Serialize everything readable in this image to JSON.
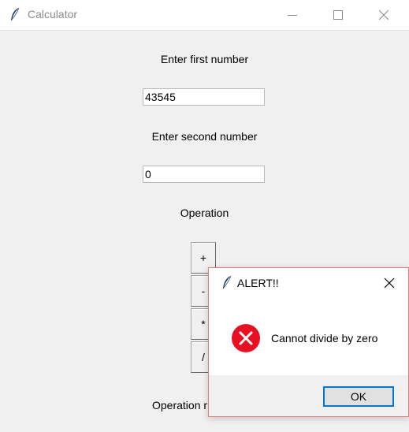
{
  "window": {
    "title": "Calculator",
    "icon": "feather-icon"
  },
  "form": {
    "first_label": "Enter first number",
    "first_value": "43545",
    "second_label": "Enter second number",
    "second_value": "0",
    "operation_label": "Operation",
    "buttons": [
      "+",
      "-",
      "*",
      "/"
    ],
    "result_label": "Operation r"
  },
  "dialog": {
    "title": "ALERT!!",
    "icon": "error-icon",
    "message": "Cannot divide by zero",
    "ok_label": "OK"
  },
  "colors": {
    "error_red": "#e81123",
    "accent_blue": "#0078d7",
    "dialog_border": "#e07f7f"
  }
}
